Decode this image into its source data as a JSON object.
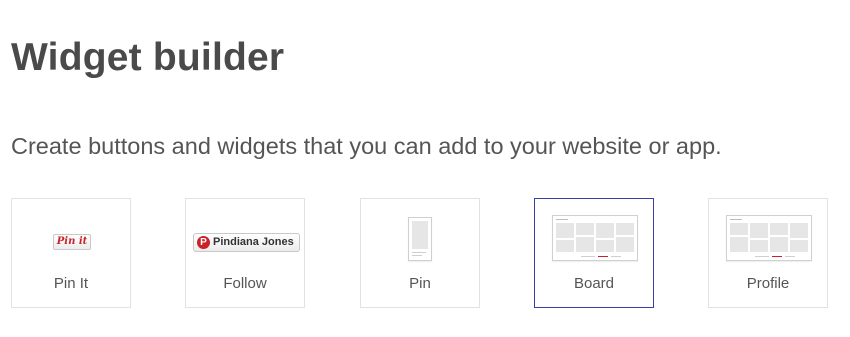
{
  "page": {
    "title": "Widget builder",
    "subtitle": "Create buttons and widgets that you can add to your website or app."
  },
  "widgets": [
    {
      "label": "Pin It",
      "preview_text": "Pin it",
      "selected": false
    },
    {
      "label": "Follow",
      "preview_text": "Pindiana Jones",
      "selected": false
    },
    {
      "label": "Pin",
      "selected": false
    },
    {
      "label": "Board",
      "selected": true
    },
    {
      "label": "Profile",
      "selected": false
    }
  ],
  "colors": {
    "brand_red": "#cb2027",
    "selected_border": "#3a3fa8",
    "card_border": "#e2e2e2",
    "text": "#555555"
  }
}
